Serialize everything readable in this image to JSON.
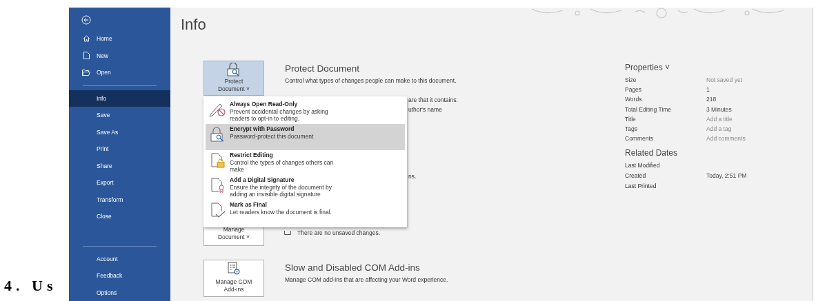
{
  "document_text": {
    "heading": "4. Us"
  },
  "sidebar": {
    "items": [
      {
        "label": "Home",
        "selected": false
      },
      {
        "label": "New",
        "selected": false
      },
      {
        "label": "Open",
        "selected": false
      },
      {
        "label": "Info",
        "selected": true
      },
      {
        "label": "Save",
        "selected": false
      },
      {
        "label": "Save As",
        "selected": false
      },
      {
        "label": "Print",
        "selected": false
      },
      {
        "label": "Share",
        "selected": false
      },
      {
        "label": "Export",
        "selected": false
      },
      {
        "label": "Transform",
        "selected": false
      },
      {
        "label": "Close",
        "selected": false
      }
    ],
    "bottom_items": [
      {
        "label": "Account",
        "selected": false
      },
      {
        "label": "Feedback",
        "selected": false
      },
      {
        "label": "Options",
        "selected": false
      }
    ]
  },
  "title": "Info",
  "protect": {
    "button_label": "Protect Document ˅",
    "title": "Protect Document",
    "description": "Control what types of changes people can make to this document."
  },
  "hidden_fragments": [
    "are that it contains:",
    "uthor's name",
    "ns."
  ],
  "manage": {
    "button_label": "Manage Document ˅",
    "status": "There are no unsaved changes."
  },
  "addins": {
    "button_label": "Manage COM Add-ins",
    "title": "Slow and Disabled COM Add-ins",
    "description": "Manage COM add-ins that are affecting your Word experience."
  },
  "protect_menu": [
    {
      "title": "Always Open Read-Only",
      "description": "Prevent accidental changes by asking readers to opt-in to editing.",
      "selected": false
    },
    {
      "title": "Encrypt with Password",
      "description": "Password-protect this document",
      "selected": true
    },
    {
      "title": "Restrict Editing",
      "description": "Control the types of changes others can make",
      "selected": false
    },
    {
      "title": "Add a Digital Signature",
      "description": "Ensure the integrity of the document by adding an invisible digital signature",
      "selected": false
    },
    {
      "title": "Mark as Final",
      "description": "Let readers know the document is final.",
      "selected": false
    }
  ],
  "properties": {
    "title": "Properties ˅",
    "rows": [
      {
        "label": "Size",
        "placeholder": "Not saved yet"
      },
      {
        "label": "Pages",
        "value": "1"
      },
      {
        "label": "Words",
        "value": "218"
      },
      {
        "label": "Total Editing Time",
        "value": "3 Minutes"
      },
      {
        "label": "Title",
        "placeholder": "Add a title"
      },
      {
        "label": "Tags",
        "placeholder": "Add a tag"
      },
      {
        "label": "Comments",
        "placeholder": "Add comments"
      }
    ]
  },
  "related_dates": {
    "title": "Related Dates",
    "rows": [
      {
        "label": "Last Modified"
      },
      {
        "label": "Created",
        "value": "Today, 2:51 PM"
      },
      {
        "label": "Last Printed"
      }
    ]
  }
}
